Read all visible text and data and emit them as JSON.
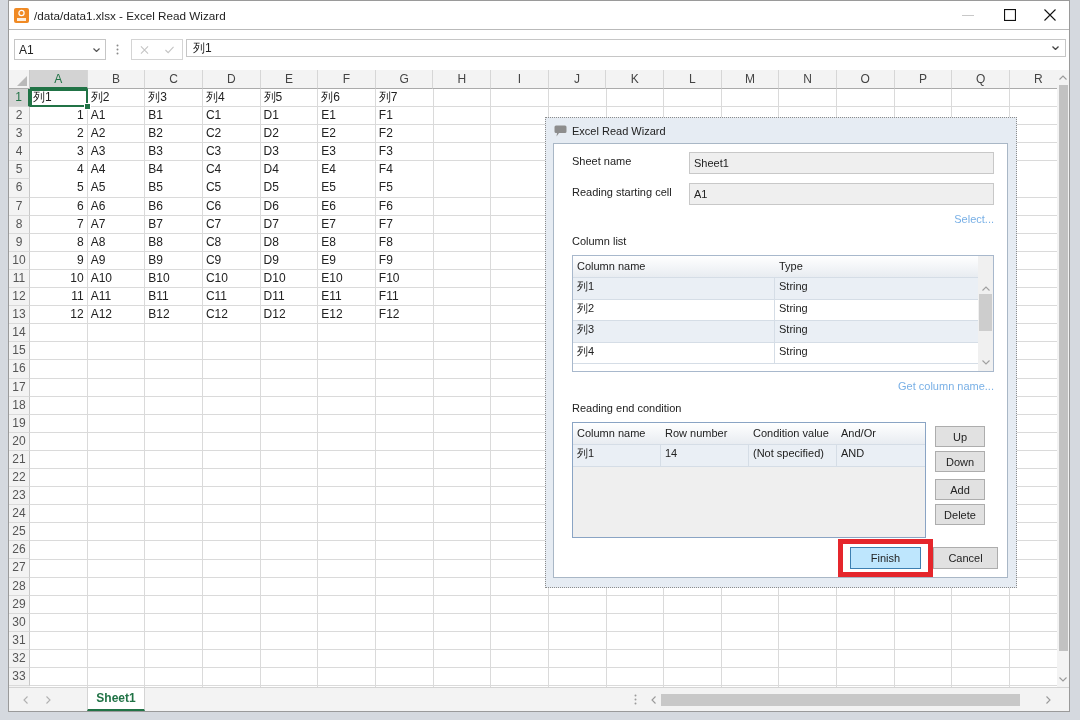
{
  "window": {
    "title": "/data/data1.xlsx - Excel Read Wizard",
    "minimize": {
      "disabled": true
    }
  },
  "formula_bar": {
    "name_box": "A1",
    "edit_buttons": {
      "disabled": true
    },
    "formula": "列1"
  },
  "sheet": {
    "columns": [
      {
        "label": "A",
        "selected": true
      },
      {
        "label": "B",
        "selected": false
      },
      {
        "label": "C",
        "selected": false
      },
      {
        "label": "D",
        "selected": false
      },
      {
        "label": "E",
        "selected": false
      },
      {
        "label": "F",
        "selected": false
      },
      {
        "label": "G",
        "selected": false
      },
      {
        "label": "H",
        "selected": false
      },
      {
        "label": "I",
        "selected": false
      },
      {
        "label": "J",
        "selected": false
      },
      {
        "label": "K",
        "selected": false
      },
      {
        "label": "L",
        "selected": false
      },
      {
        "label": "M",
        "selected": false
      },
      {
        "label": "N",
        "selected": false
      },
      {
        "label": "O",
        "selected": false
      },
      {
        "label": "P",
        "selected": false
      },
      {
        "label": "Q",
        "selected": false
      },
      {
        "label": "R",
        "selected": false
      }
    ],
    "rows": [
      {
        "label": "1",
        "selected": true,
        "cells": [
          {
            "text": "列1",
            "kind": "text"
          },
          {
            "text": "列2",
            "kind": "text"
          },
          {
            "text": "列3",
            "kind": "text"
          },
          {
            "text": "列4",
            "kind": "text"
          },
          {
            "text": "列5",
            "kind": "text"
          },
          {
            "text": "列6",
            "kind": "text"
          },
          {
            "text": "列7",
            "kind": "text"
          }
        ]
      },
      {
        "label": "2",
        "selected": false,
        "cells": [
          {
            "text": "1",
            "kind": "number"
          },
          {
            "text": "A1",
            "kind": "text"
          },
          {
            "text": "B1",
            "kind": "text"
          },
          {
            "text": "C1",
            "kind": "text"
          },
          {
            "text": "D1",
            "kind": "text"
          },
          {
            "text": "E1",
            "kind": "text"
          },
          {
            "text": "F1",
            "kind": "text"
          }
        ]
      },
      {
        "label": "3",
        "selected": false,
        "cells": [
          {
            "text": "2",
            "kind": "number"
          },
          {
            "text": "A2",
            "kind": "text"
          },
          {
            "text": "B2",
            "kind": "text"
          },
          {
            "text": "C2",
            "kind": "text"
          },
          {
            "text": "D2",
            "kind": "text"
          },
          {
            "text": "E2",
            "kind": "text"
          },
          {
            "text": "F2",
            "kind": "text"
          }
        ]
      },
      {
        "label": "4",
        "selected": false,
        "cells": [
          {
            "text": "3",
            "kind": "number"
          },
          {
            "text": "A3",
            "kind": "text"
          },
          {
            "text": "B3",
            "kind": "text"
          },
          {
            "text": "C3",
            "kind": "text"
          },
          {
            "text": "D3",
            "kind": "text"
          },
          {
            "text": "E3",
            "kind": "text"
          },
          {
            "text": "F3",
            "kind": "text"
          }
        ]
      },
      {
        "label": "5",
        "selected": false,
        "cells": [
          {
            "text": "4",
            "kind": "number"
          },
          {
            "text": "A4",
            "kind": "text"
          },
          {
            "text": "B4",
            "kind": "text"
          },
          {
            "text": "C4",
            "kind": "text"
          },
          {
            "text": "D4",
            "kind": "text"
          },
          {
            "text": "E4",
            "kind": "text"
          },
          {
            "text": "F4",
            "kind": "text"
          }
        ]
      },
      {
        "label": "6",
        "selected": false,
        "cells": [
          {
            "text": "5",
            "kind": "number"
          },
          {
            "text": "A5",
            "kind": "text"
          },
          {
            "text": "B5",
            "kind": "text"
          },
          {
            "text": "C5",
            "kind": "text"
          },
          {
            "text": "D5",
            "kind": "text"
          },
          {
            "text": "E5",
            "kind": "text"
          },
          {
            "text": "F5",
            "kind": "text"
          }
        ]
      },
      {
        "label": "7",
        "selected": false,
        "cells": [
          {
            "text": "6",
            "kind": "number"
          },
          {
            "text": "A6",
            "kind": "text"
          },
          {
            "text": "B6",
            "kind": "text"
          },
          {
            "text": "C6",
            "kind": "text"
          },
          {
            "text": "D6",
            "kind": "text"
          },
          {
            "text": "E6",
            "kind": "text"
          },
          {
            "text": "F6",
            "kind": "text"
          }
        ]
      },
      {
        "label": "8",
        "selected": false,
        "cells": [
          {
            "text": "7",
            "kind": "number"
          },
          {
            "text": "A7",
            "kind": "text"
          },
          {
            "text": "B7",
            "kind": "text"
          },
          {
            "text": "C7",
            "kind": "text"
          },
          {
            "text": "D7",
            "kind": "text"
          },
          {
            "text": "E7",
            "kind": "text"
          },
          {
            "text": "F7",
            "kind": "text"
          }
        ]
      },
      {
        "label": "9",
        "selected": false,
        "cells": [
          {
            "text": "8",
            "kind": "number"
          },
          {
            "text": "A8",
            "kind": "text"
          },
          {
            "text": "B8",
            "kind": "text"
          },
          {
            "text": "C8",
            "kind": "text"
          },
          {
            "text": "D8",
            "kind": "text"
          },
          {
            "text": "E8",
            "kind": "text"
          },
          {
            "text": "F8",
            "kind": "text"
          }
        ]
      },
      {
        "label": "10",
        "selected": false,
        "cells": [
          {
            "text": "9",
            "kind": "number"
          },
          {
            "text": "A9",
            "kind": "text"
          },
          {
            "text": "B9",
            "kind": "text"
          },
          {
            "text": "C9",
            "kind": "text"
          },
          {
            "text": "D9",
            "kind": "text"
          },
          {
            "text": "E9",
            "kind": "text"
          },
          {
            "text": "F9",
            "kind": "text"
          }
        ]
      },
      {
        "label": "11",
        "selected": false,
        "cells": [
          {
            "text": "10",
            "kind": "number"
          },
          {
            "text": "A10",
            "kind": "text"
          },
          {
            "text": "B10",
            "kind": "text"
          },
          {
            "text": "C10",
            "kind": "text"
          },
          {
            "text": "D10",
            "kind": "text"
          },
          {
            "text": "E10",
            "kind": "text"
          },
          {
            "text": "F10",
            "kind": "text"
          }
        ]
      },
      {
        "label": "12",
        "selected": false,
        "cells": [
          {
            "text": "11",
            "kind": "number"
          },
          {
            "text": "A11",
            "kind": "text"
          },
          {
            "text": "B11",
            "kind": "text"
          },
          {
            "text": "C11",
            "kind": "text"
          },
          {
            "text": "D11",
            "kind": "text"
          },
          {
            "text": "E11",
            "kind": "text"
          },
          {
            "text": "F11",
            "kind": "text"
          }
        ]
      },
      {
        "label": "13",
        "selected": false,
        "cells": [
          {
            "text": "12",
            "kind": "number"
          },
          {
            "text": "A12",
            "kind": "text"
          },
          {
            "text": "B12",
            "kind": "text"
          },
          {
            "text": "C12",
            "kind": "text"
          },
          {
            "text": "D12",
            "kind": "text"
          },
          {
            "text": "E12",
            "kind": "text"
          },
          {
            "text": "F12",
            "kind": "text"
          }
        ]
      },
      {
        "label": "14",
        "selected": false
      },
      {
        "label": "15",
        "selected": false
      },
      {
        "label": "16",
        "selected": false
      },
      {
        "label": "17",
        "selected": false
      },
      {
        "label": "18",
        "selected": false
      },
      {
        "label": "19",
        "selected": false
      },
      {
        "label": "20",
        "selected": false
      },
      {
        "label": "21",
        "selected": false
      },
      {
        "label": "22",
        "selected": false
      },
      {
        "label": "23",
        "selected": false
      },
      {
        "label": "24",
        "selected": false
      },
      {
        "label": "25",
        "selected": false
      },
      {
        "label": "26",
        "selected": false
      },
      {
        "label": "27",
        "selected": false
      },
      {
        "label": "28",
        "selected": false
      },
      {
        "label": "29",
        "selected": false
      },
      {
        "label": "30",
        "selected": false
      },
      {
        "label": "31",
        "selected": false
      },
      {
        "label": "32",
        "selected": false
      },
      {
        "label": "33",
        "selected": false
      }
    ],
    "tabs": [
      {
        "label": "Sheet1",
        "selected": true
      }
    ]
  },
  "dialog": {
    "title": "Excel Read Wizard",
    "fields": [
      {
        "label": "Sheet name",
        "value": "Sheet1"
      },
      {
        "label": "Reading starting cell",
        "value": "A1"
      }
    ],
    "select_link": "Select...",
    "column_list": {
      "title": "Column list",
      "columns": [
        "Column name",
        "Type"
      ],
      "rows": [
        [
          "列1",
          "String"
        ],
        [
          "列2",
          "String"
        ],
        [
          "列3",
          "String"
        ],
        [
          "列4",
          "String"
        ]
      ]
    },
    "get_columns_link": "Get column name...",
    "end_condition": {
      "title": "Reading end condition",
      "columns": [
        "Column name",
        "Row number",
        "Condition value",
        "And/Or"
      ],
      "rows": [
        [
          "列1",
          "14",
          "(Not specified)",
          "AND"
        ]
      ]
    },
    "side_buttons": [
      "Up",
      "Down",
      "Add",
      "Delete"
    ],
    "buttons": [
      {
        "label": "Finish",
        "default": true,
        "highlighted": true
      },
      {
        "label": "Cancel",
        "default": false,
        "highlighted": false
      }
    ]
  }
}
